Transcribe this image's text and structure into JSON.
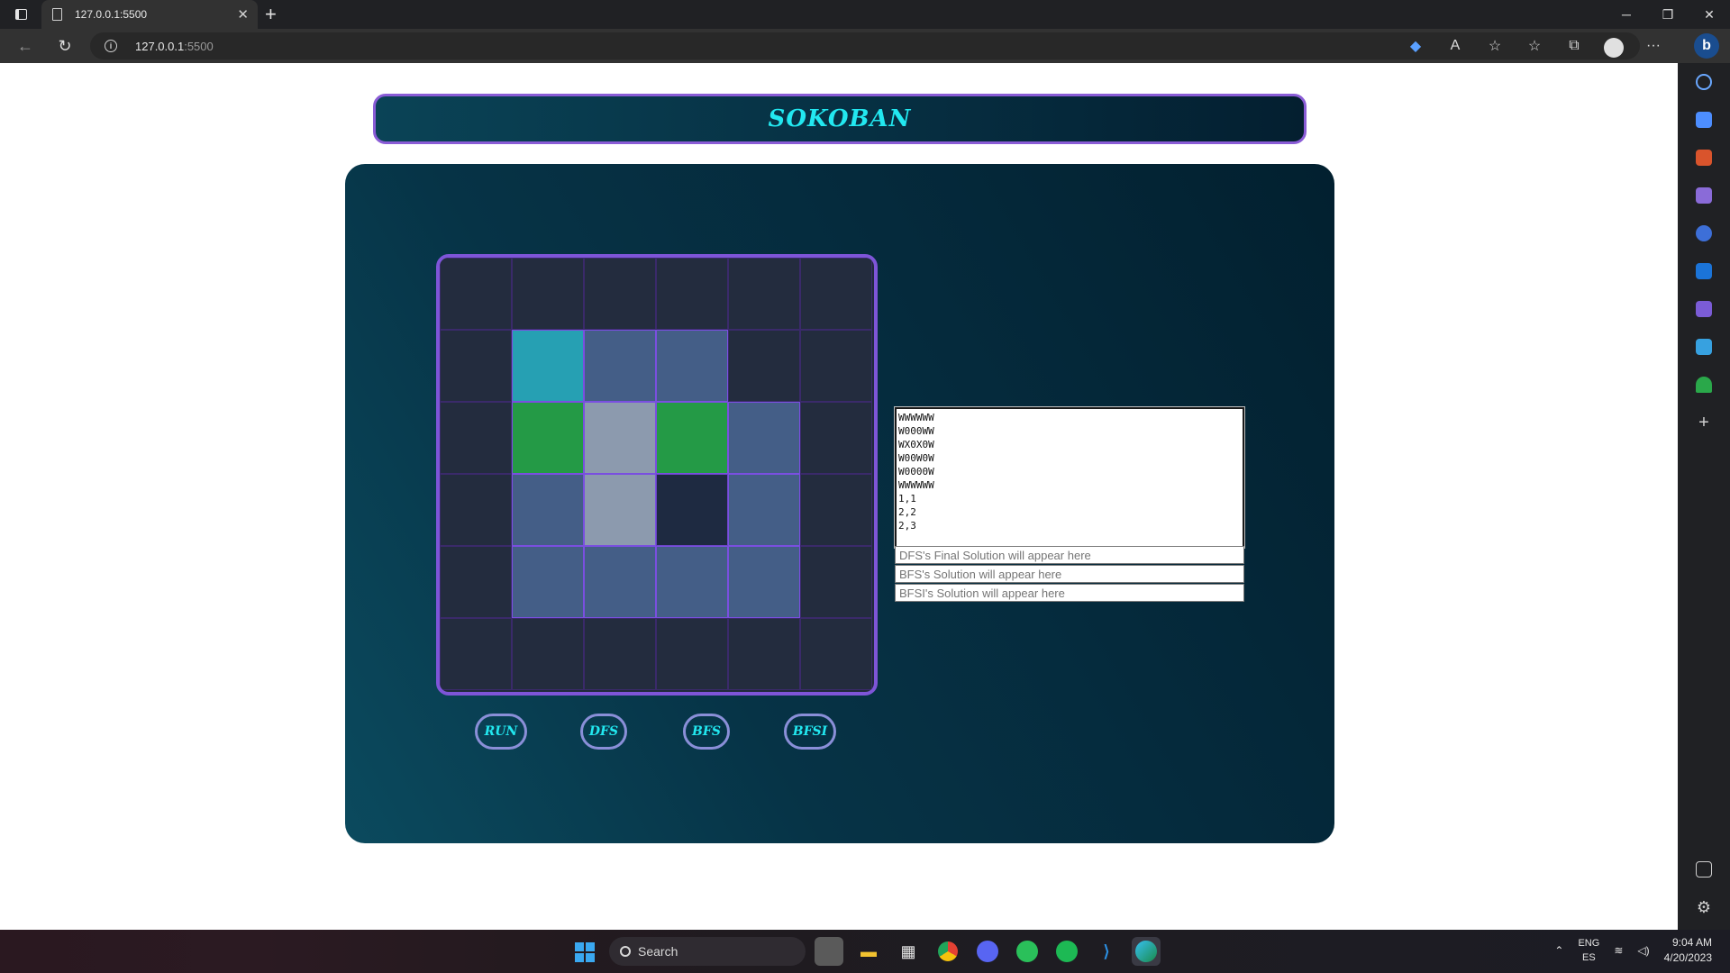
{
  "browser": {
    "tab_title": "127.0.0.1:5500",
    "url_host": "127.0.0.1",
    "url_port": ":5500"
  },
  "page": {
    "title": "SOKOBAN",
    "board": [
      [
        "w",
        "w",
        "w",
        "w",
        "w",
        "w"
      ],
      [
        "w",
        "t",
        "f",
        "f",
        "w",
        "w"
      ],
      [
        "w",
        "g",
        "x",
        "g",
        "f",
        "w"
      ],
      [
        "w",
        "f",
        "x",
        "e",
        "f",
        "w"
      ],
      [
        "w",
        "f",
        "f",
        "f",
        "f",
        "w"
      ],
      [
        "w",
        "w",
        "w",
        "w",
        "w",
        "w"
      ]
    ],
    "buttons": {
      "run": "RUN",
      "dfs": "DFS",
      "bfs": "BFS",
      "bfsi": "BFSI"
    },
    "map_input": "WWWWWW\nW000WW\nWX0X0W\nW00W0W\nW0000W\nWWWWWW\n1,1\n2,2\n2,3\n",
    "dfs_placeholder": "DFS's Final Solution will appear here",
    "bfs_placeholder": "BFS's Solution will appear here",
    "bfsi_placeholder": "BFSI's Solution will appear here"
  },
  "taskbar": {
    "search_label": "Search",
    "lang_top": "ENG",
    "lang_bottom": "ES",
    "time": "9:04 AM",
    "date": "4/20/2023"
  },
  "colors": {
    "accent_cyan": "#22e8f0",
    "frame_purple": "#7e55d8",
    "goal_green": "#249a46",
    "player_teal": "#26a0b3"
  }
}
